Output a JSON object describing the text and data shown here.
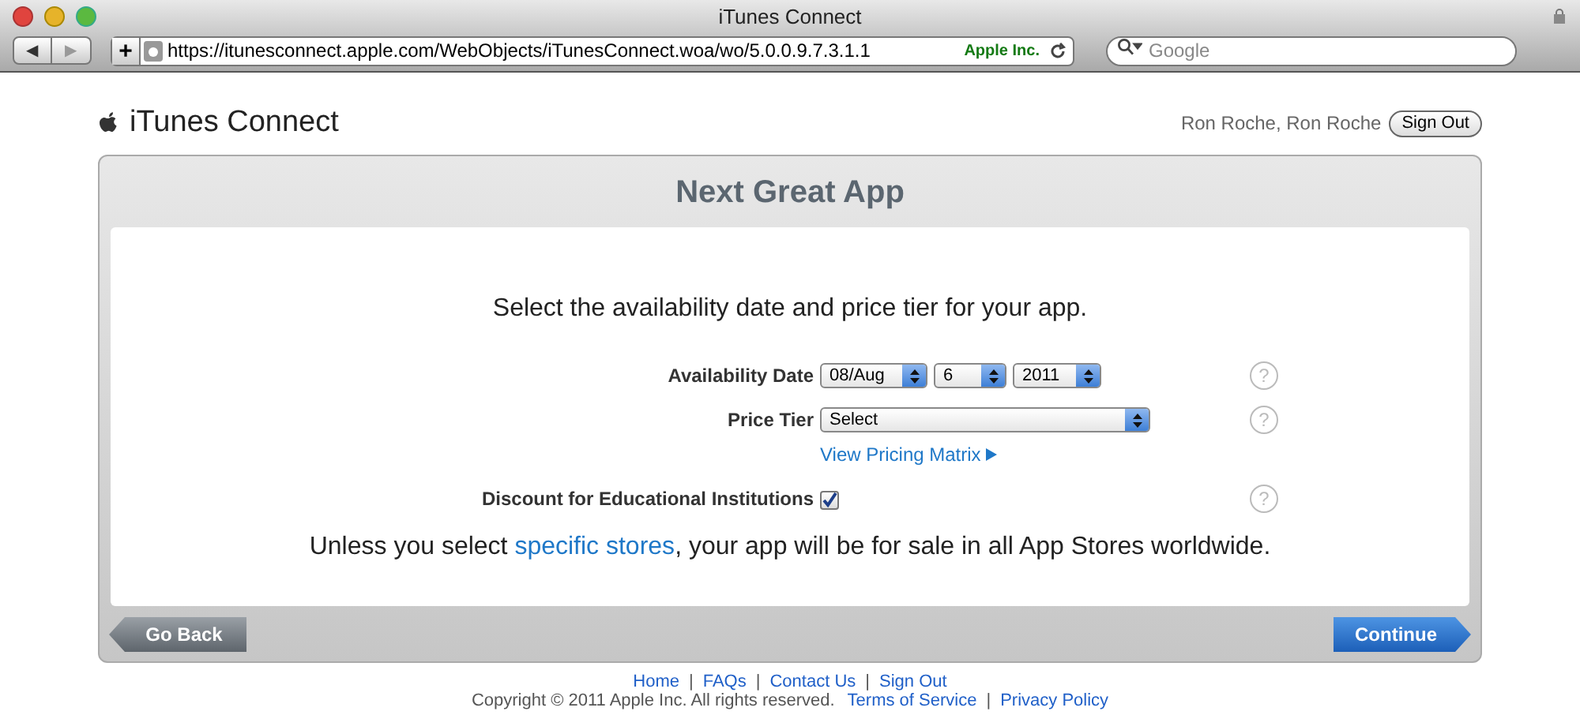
{
  "window": {
    "title": "iTunes Connect"
  },
  "toolbar": {
    "back": "◀",
    "forward": "▶",
    "add": "+",
    "url": "https://itunesconnect.apple.com/WebObjects/iTunesConnect.woa/wo/5.0.0.9.7.3.1.1",
    "site_identity": "Apple Inc.",
    "search_placeholder": "Google"
  },
  "header": {
    "logo": "iTunes Connect",
    "user": "Ron Roche, Ron Roche",
    "sign_out": "Sign Out"
  },
  "panel": {
    "title": "Next Great App",
    "instruction": "Select the availability date and price tier for your app.",
    "availability": {
      "label": "Availability Date",
      "selects": [
        "08/Aug",
        "6",
        "2011"
      ],
      "help": "?"
    },
    "price_tier": {
      "label": "Price Tier",
      "select": "Select",
      "help": "?",
      "link": "View Pricing Matrix"
    },
    "discount": {
      "label": "Discount for Educational Institutions",
      "checked": true,
      "help": "?"
    },
    "notice": [
      "Unless you select ",
      "specific stores",
      ", your app will be for sale in all App Stores worldwide."
    ],
    "back_button": "Go Back",
    "continue_button": "Continue"
  },
  "footer": {
    "separator": "|",
    "links": [
      "Home",
      "FAQs",
      "Contact Us",
      "Sign Out"
    ],
    "copyright": "Copyright © 2011 Apple Inc. All rights reserved.",
    "legal_links": [
      "Terms of Service",
      "Privacy Policy"
    ]
  }
}
